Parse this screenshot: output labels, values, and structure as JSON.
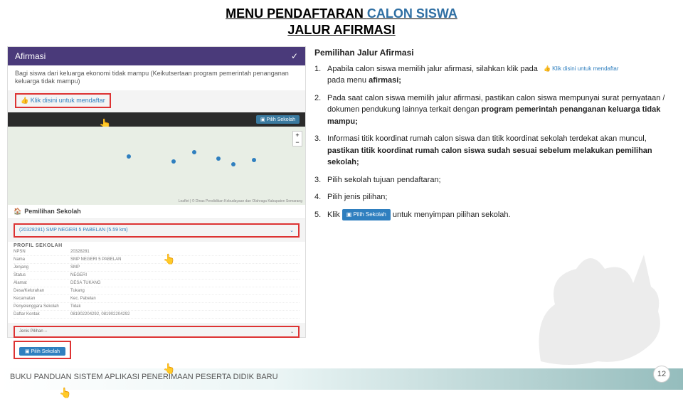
{
  "title": {
    "part1": "MENU PENDAFTARAN ",
    "part2": "CALON SISWA",
    "line2": "JALUR AFIRMASI"
  },
  "screenshot": {
    "header_title": "Afirmasi",
    "sub_text": "Bagi siswa dari keluarga ekonomi tidak mampu (Keikutsertaan program pemerintah penanganan keluarga tidak mampu)",
    "register_link": "Klik disini untuk mendaftar",
    "pilih_sekolah_btn": "Pilih Sekolah",
    "pemilihan_label": "Pemilihan Sekolah",
    "school_option": "(20328281) SMP NEGERI 5 PABELAN (5.59 km)",
    "profile_header": "PROFIL SEKOLAH",
    "profile": [
      {
        "k": "NPSN",
        "v": "20328281"
      },
      {
        "k": "Nama",
        "v": "SMP NEGERI 5 PABELAN"
      },
      {
        "k": "Jenjang",
        "v": "SMP"
      },
      {
        "k": "Status",
        "v": "NEGERI"
      },
      {
        "k": "Alamat",
        "v": "DESA TUKANG"
      },
      {
        "k": "Desa/Kelurahan",
        "v": "Tukang"
      },
      {
        "k": "Kecamatan",
        "v": "Kec. Pabelan"
      },
      {
        "k": "Penyelenggara Sekolah",
        "v": "Tidak"
      },
      {
        "k": "Daftar Kontak",
        "v": "081902204292, 081902204292"
      }
    ],
    "jenis_label": "Jenis Pilihan",
    "jenis_placeholder": "Jenis Pilihan --",
    "pilih_btn_label": "Pilih Sekolah",
    "map_credit": "Leaflet | © Dinas Pendidikan Kebudayaan dan Olahraga Kabupaten Semarang"
  },
  "instructions": {
    "header": "Pemilihan Jalur Afirmasi",
    "items": [
      {
        "num": "1.",
        "pre": "Apabila calon siswa memilih jalur afirmasi, silahkan klik pada",
        "link": "Klik disini untuk mendaftar",
        "post1": "pada menu ",
        "bold1": "afirmasi;"
      },
      {
        "num": "2.",
        "text": "Pada saat calon siswa memilih jalur afirmasi, pastikan calon siswa mempunyai surat pernyataan / dokumen pendukung lainnya terkait dengan ",
        "bold": "program pemerintah penanganan keluarga tidak mampu;"
      },
      {
        "num": "3.",
        "text1": "Informasi titik koordinat rumah calon siswa dan titik koordinat sekolah terdekat akan muncul, ",
        "bold1": "pastikan titik koordinat rumah calon siswa sudah sesuai sebelum melakukan pemilihan sekolah;"
      },
      {
        "num": "3.",
        "text": "Pilih sekolah tujuan pendaftaran;"
      },
      {
        "num": "4.",
        "text": "Pilih jenis pilihan;"
      },
      {
        "num": "5.",
        "pre": "Klik ",
        "btn": "Pilih Sekolah",
        "post": " untuk menyimpan pilihan sekolah."
      }
    ]
  },
  "footer": {
    "text": "BUKU PANDUAN SISTEM APLIKASI PENERIMAAN PESERTA DIDIK BARU",
    "page": "12"
  }
}
